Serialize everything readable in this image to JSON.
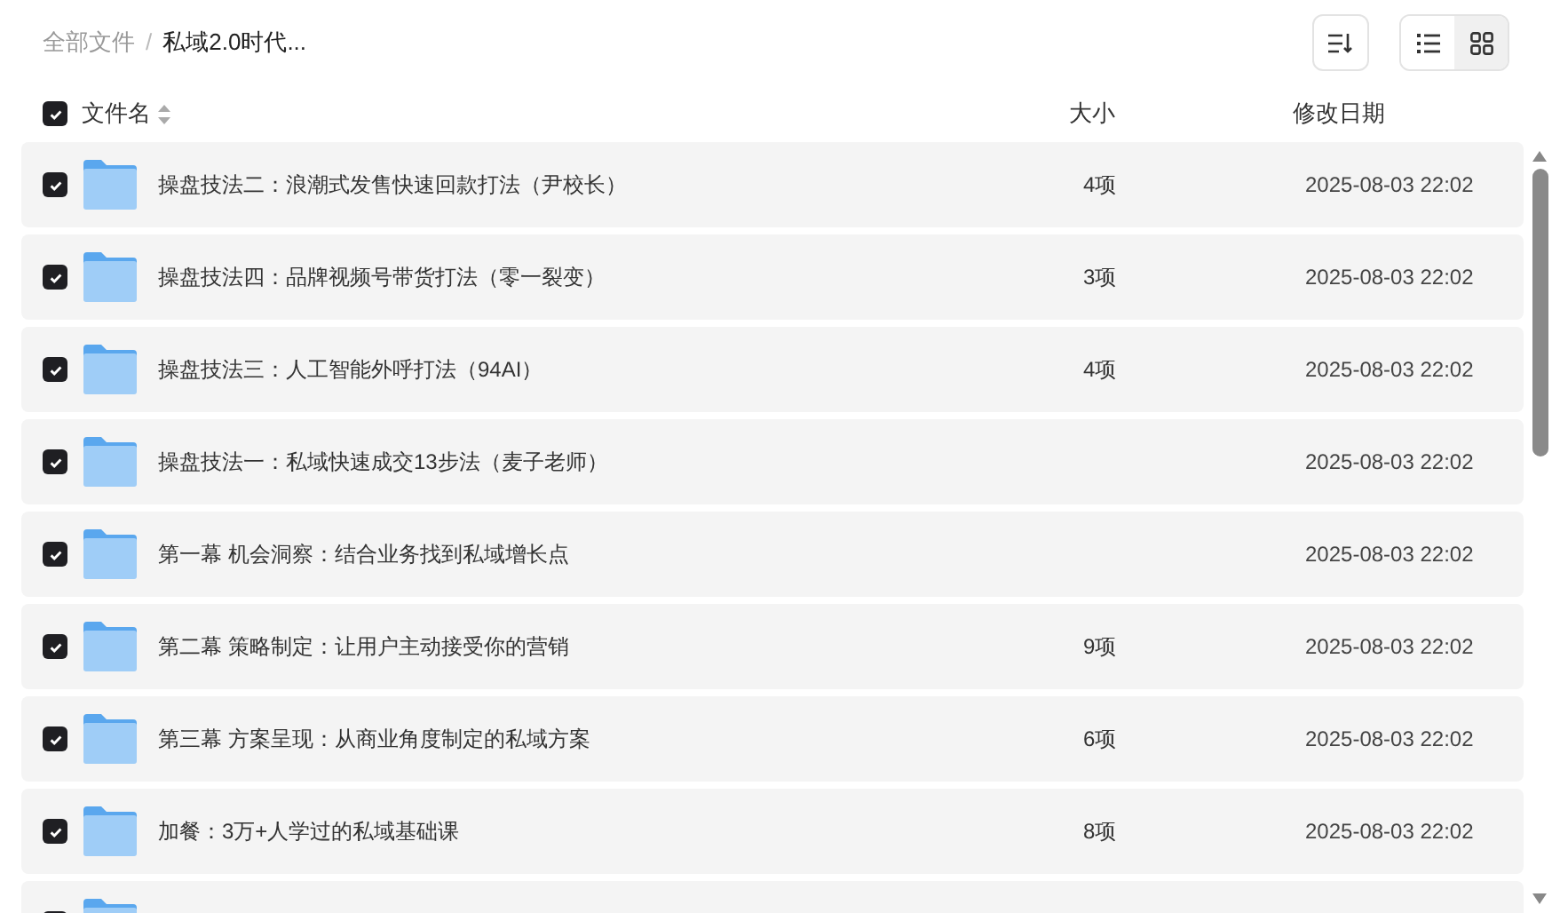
{
  "breadcrumb_separator": "/",
  "breadcrumb": [
    {
      "label": "全部文件",
      "current": false
    },
    {
      "label": "私域2.0时代...",
      "current": true
    }
  ],
  "view_modes": [
    {
      "kind": "list",
      "selected": true
    },
    {
      "kind": "grid",
      "selected": false
    }
  ],
  "table": {
    "select_all_checked": true,
    "columns": [
      "文件名",
      "大小",
      "修改日期"
    ],
    "rows": [
      {
        "checked": true,
        "name": "操盘技法二：浪潮式发售快速回款打法（尹校长）",
        "size": "4项",
        "date": "2025-08-03 22:02"
      },
      {
        "checked": true,
        "name": "操盘技法四：品牌视频号带货打法（零一裂变）",
        "size": "3项",
        "date": "2025-08-03 22:02"
      },
      {
        "checked": true,
        "name": "操盘技法三：人工智能外呼打法（94AI）",
        "size": "4项",
        "date": "2025-08-03 22:02"
      },
      {
        "checked": true,
        "name": "操盘技法一：私域快速成交13步法（麦子老师）",
        "date": "2025-08-03 22:02"
      },
      {
        "checked": true,
        "name": "第一幕 机会洞察：结合业务找到私域增长点",
        "date": "2025-08-03 22:02"
      },
      {
        "checked": true,
        "name": "第二幕 策略制定：让用户主动接受你的营销",
        "size": "9项",
        "date": "2025-08-03 22:02"
      },
      {
        "checked": true,
        "name": "第三幕 方案呈现：从商业角度制定的私域方案",
        "size": "6项",
        "date": "2025-08-03 22:02"
      },
      {
        "checked": true,
        "name": "加餐：3万+人学过的私域基础课",
        "size": "8项",
        "date": "2025-08-03 22:02"
      },
      {
        "checked": true
      }
    ]
  }
}
